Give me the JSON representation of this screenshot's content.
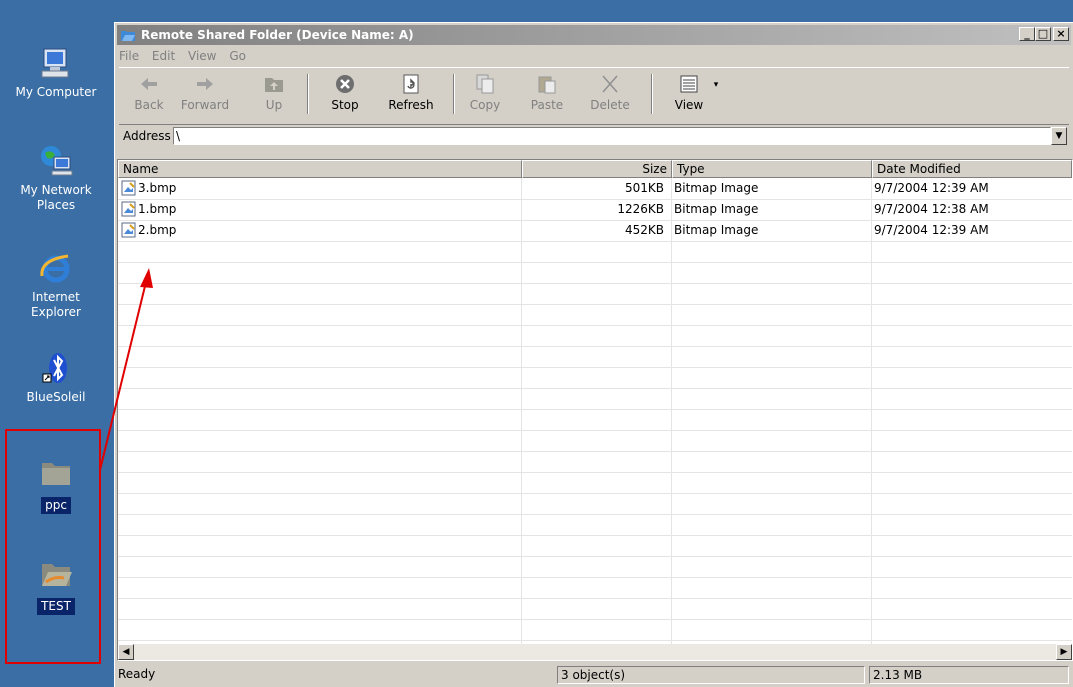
{
  "desktop": {
    "icons": [
      {
        "label": "My Computer",
        "icon": "my-computer-icon"
      },
      {
        "label": "My Network\nPlaces",
        "icon": "network-places-icon"
      },
      {
        "label": "Internet\nExplorer",
        "icon": "internet-explorer-icon"
      },
      {
        "label": "BlueSoleil",
        "icon": "bluesoleil-icon"
      },
      {
        "label": "ppc",
        "icon": "folder-icon"
      },
      {
        "label": "TEST",
        "icon": "open-folder-icon"
      }
    ]
  },
  "window": {
    "title": "Remote Shared Folder (Device Name: A)",
    "controls": {
      "minimize": "_",
      "maximize": "□",
      "close": "×"
    },
    "menu": [
      "File",
      "Edit",
      "View",
      "Go"
    ],
    "toolbar": {
      "back": "Back",
      "forward": "Forward",
      "up": "Up",
      "stop": "Stop",
      "refresh": "Refresh",
      "copy": "Copy",
      "paste": "Paste",
      "delete": "Delete",
      "view": "View"
    },
    "address": {
      "label": "Address",
      "value": "\\"
    },
    "columns": {
      "name": "Name",
      "size": "Size",
      "type": "Type",
      "date": "Date Modified"
    },
    "files": [
      {
        "name": "3.bmp",
        "size": "501KB",
        "type": "Bitmap Image",
        "date": "9/7/2004 12:39 AM"
      },
      {
        "name": "1.bmp",
        "size": "1226KB",
        "type": "Bitmap Image",
        "date": "9/7/2004 12:38 AM"
      },
      {
        "name": "2.bmp",
        "size": "452KB",
        "type": "Bitmap Image",
        "date": "9/7/2004 12:39 AM"
      }
    ],
    "status": {
      "state": "Ready",
      "objects": "3 object(s)",
      "total_size": "2.13 MB"
    }
  },
  "colors": {
    "desktop": "#3a6ea5",
    "selection": "#0a246a",
    "annotation": "#e00000",
    "window_face": "#d4d0c8"
  }
}
